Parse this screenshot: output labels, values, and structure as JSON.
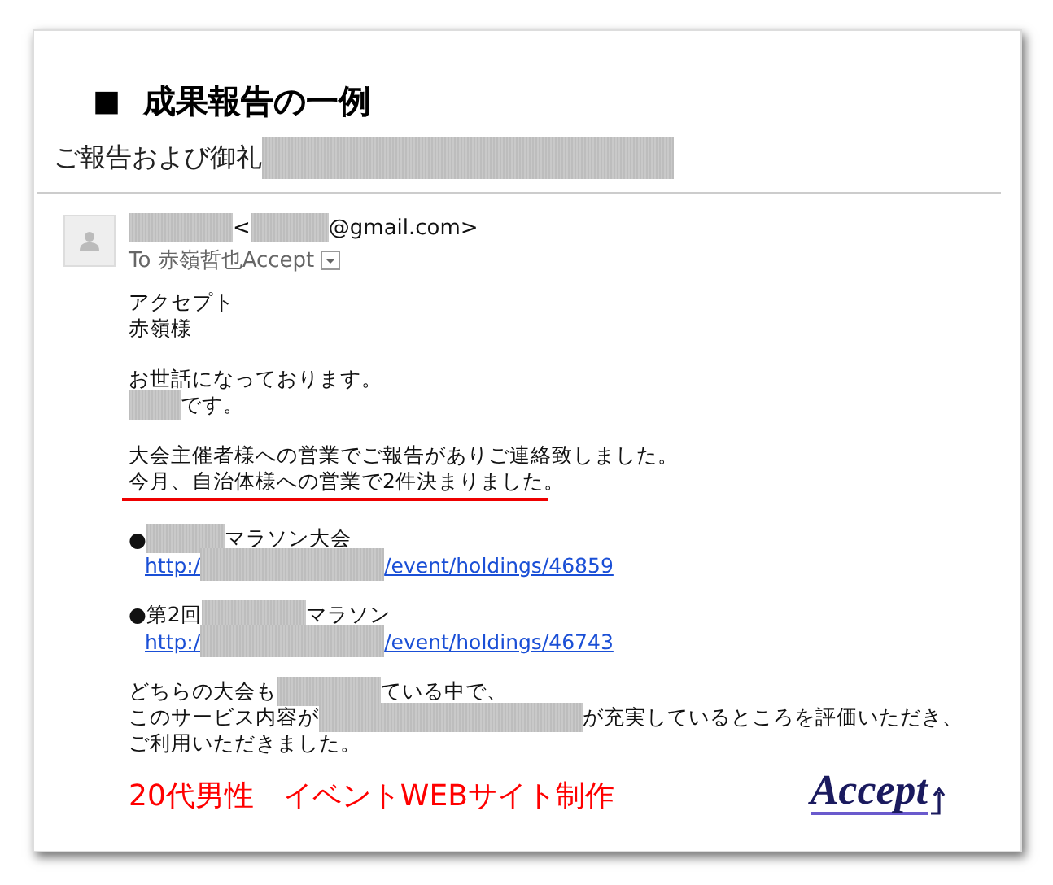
{
  "heading": {
    "marker": "■",
    "text": "成果報告の一例"
  },
  "subject": [
    {
      "kind": "text",
      "text": "ご報告および御礼"
    },
    {
      "kind": "redacted"
    }
  ],
  "sender": [
    {
      "kind": "redacted"
    },
    {
      "kind": "text",
      "text": " <"
    },
    {
      "kind": "redacted"
    },
    {
      "kind": "text",
      "text": "@gmail.com>"
    }
  ],
  "recipient": "To 赤嶺哲也Accept",
  "body": [
    {
      "kind": "text",
      "underlined": false,
      "parts": [
        {
          "kind": "text",
          "text": "アクセプト"
        }
      ]
    },
    {
      "kind": "text",
      "underlined": false,
      "parts": [
        {
          "kind": "text",
          "text": "赤嶺様"
        }
      ]
    },
    {
      "kind": "blank"
    },
    {
      "kind": "text",
      "underlined": false,
      "parts": [
        {
          "kind": "text",
          "text": "お世話になっております。"
        }
      ]
    },
    {
      "kind": "text",
      "underlined": false,
      "parts": [
        {
          "kind": "redacted"
        },
        {
          "kind": "text",
          "text": "です。"
        }
      ]
    },
    {
      "kind": "blank"
    },
    {
      "kind": "text",
      "underlined": false,
      "parts": [
        {
          "kind": "text",
          "text": "大会主催者様への営業でご報告がありご連絡致しました。"
        }
      ]
    },
    {
      "kind": "text",
      "underlined": true,
      "parts": [
        {
          "kind": "text",
          "text": "今月、自治体様への営業で2件決まりました。"
        }
      ]
    },
    {
      "kind": "blank"
    },
    {
      "kind": "text",
      "underlined": false,
      "parts": [
        {
          "kind": "text",
          "text": "●"
        },
        {
          "kind": "redacted"
        },
        {
          "kind": "text",
          "text": "マラソン大会"
        }
      ]
    },
    {
      "kind": "link",
      "parts": [
        {
          "kind": "text",
          "text": "http:/"
        },
        {
          "kind": "redacted"
        },
        {
          "kind": "text",
          "text": "/event/holdings/46859"
        }
      ]
    },
    {
      "kind": "blank"
    },
    {
      "kind": "text",
      "underlined": false,
      "parts": [
        {
          "kind": "text",
          "text": "●第2回 "
        },
        {
          "kind": "redacted"
        },
        {
          "kind": "text",
          "text": "マラソン"
        }
      ]
    },
    {
      "kind": "link",
      "parts": [
        {
          "kind": "text",
          "text": "http:/"
        },
        {
          "kind": "redacted"
        },
        {
          "kind": "text",
          "text": "/event/holdings/46743"
        }
      ]
    },
    {
      "kind": "blank"
    },
    {
      "kind": "text",
      "underlined": false,
      "parts": [
        {
          "kind": "text",
          "text": "どちらの大会も"
        },
        {
          "kind": "redacted"
        },
        {
          "kind": "text",
          "text": "ている中で、"
        }
      ]
    },
    {
      "kind": "text",
      "underlined": false,
      "parts": [
        {
          "kind": "text",
          "text": "このサービス内容が"
        },
        {
          "kind": "redacted"
        },
        {
          "kind": "text",
          "text": "が充実しているところを評価いただき、"
        }
      ]
    },
    {
      "kind": "text",
      "underlined": false,
      "parts": [
        {
          "kind": "text",
          "text": "ご利用いただきました。"
        }
      ]
    }
  ],
  "caption": "20代男性　イベントWEBサイト制作",
  "logo": "Accept"
}
